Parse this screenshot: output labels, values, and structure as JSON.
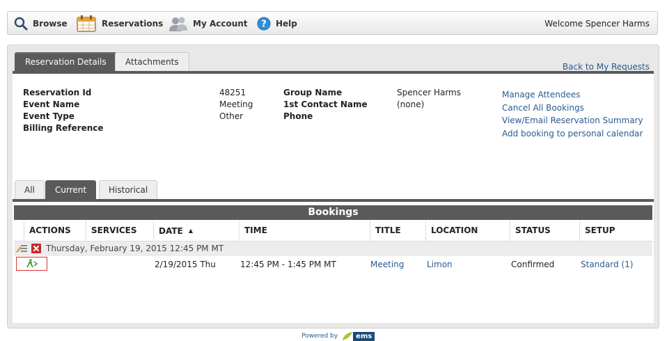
{
  "nav": {
    "items": [
      {
        "label": "Browse",
        "icon": "search-icon"
      },
      {
        "label": "Reservations",
        "icon": "calendar-icon"
      },
      {
        "label": "My Account",
        "icon": "users-icon"
      },
      {
        "label": "Help",
        "icon": "help-icon"
      }
    ],
    "welcome": "Welcome Spencer Harms"
  },
  "tabs": [
    {
      "label": "Reservation Details",
      "active": true
    },
    {
      "label": "Attachments",
      "active": false
    }
  ],
  "back_link": "Back to My Requests",
  "details": {
    "left": [
      {
        "label": "Reservation Id",
        "value": "48251"
      },
      {
        "label": "Event Name",
        "value": "Meeting"
      },
      {
        "label": "Event Type",
        "value": "Other"
      },
      {
        "label": "Billing Reference",
        "value": ""
      }
    ],
    "right": [
      {
        "label": "Group Name",
        "value": "Spencer Harms"
      },
      {
        "label": "1st Contact Name",
        "value": "(none)"
      },
      {
        "label": "Phone",
        "value": ""
      }
    ]
  },
  "actions": [
    "Manage Attendees",
    "Cancel All Bookings",
    "View/Email Reservation Summary",
    "Add booking to personal calendar"
  ],
  "subtabs": [
    {
      "label": "All",
      "active": false
    },
    {
      "label": "Current",
      "active": true
    },
    {
      "label": "Historical",
      "active": false
    }
  ],
  "bookings": {
    "title": "Bookings",
    "columns": [
      "ACTIONS",
      "SERVICES",
      "DATE",
      "TIME",
      "TITLE",
      "LOCATION",
      "STATUS",
      "SETUP"
    ],
    "sort_indicator": "▲",
    "group_label": "Thursday, February 19, 2015 12:45 PM MT",
    "rows": [
      {
        "date": "2/19/2015 Thu",
        "time": "12:45 PM - 1:45 PM MT",
        "title": "Meeting",
        "location": "Limon",
        "status": "Confirmed",
        "setup": "Standard (1)"
      }
    ]
  },
  "footer": {
    "powered_by": "Powered by",
    "logo_text": "ems"
  },
  "colors": {
    "accent": "#5a5a5a",
    "link": "#2a5a8e",
    "danger": "#c8282d",
    "logo_green": "#a4c639"
  }
}
